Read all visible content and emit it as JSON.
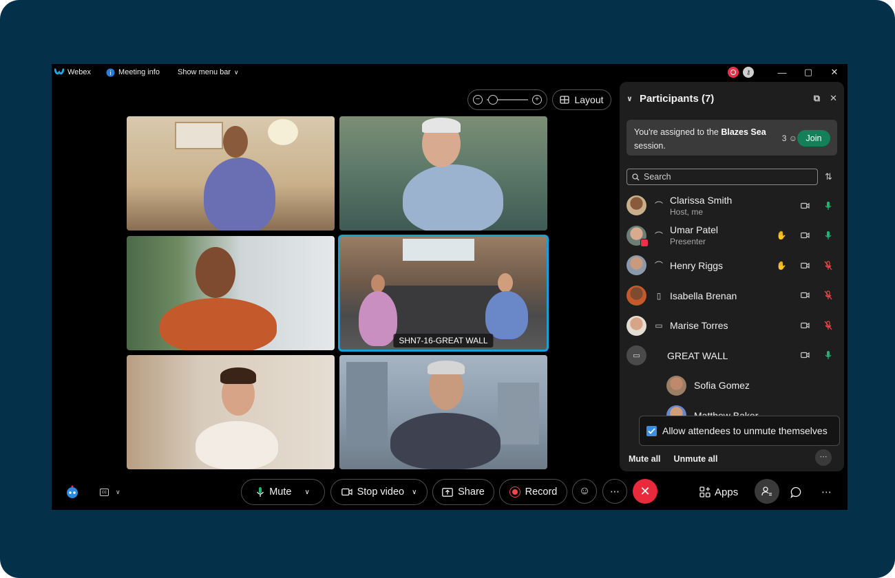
{
  "titlebar": {
    "app_name": "Webex",
    "meeting_info": "Meeting info",
    "show_menu_bar": "Show menu bar"
  },
  "stage": {
    "layout_label": "Layout",
    "zoom_level": 0.05
  },
  "tiles": [
    {
      "name": "Clarissa Smith",
      "label": ""
    },
    {
      "name": "Umar Patel",
      "label": ""
    },
    {
      "name": "Isabella Brenan",
      "label": ""
    },
    {
      "name": "GREAT WALL room",
      "label": "SHN7-16-GREAT WALL"
    },
    {
      "name": "Marise Torres",
      "label": ""
    },
    {
      "name": "Henry Riggs",
      "label": ""
    }
  ],
  "panel": {
    "title": "Participants (7)",
    "assign_prefix": "You're assigned to the ",
    "assign_session": "Blazes Sea",
    "assign_suffix": "session.",
    "assign_count": "3",
    "join_label": "Join",
    "search_placeholder": "Search",
    "participants": [
      {
        "name": "Clarissa Smith",
        "sub": "Host, me",
        "mic": "on"
      },
      {
        "name": "Umar Patel",
        "sub": "Presenter",
        "mic": "on"
      },
      {
        "name": "Henry Riggs",
        "sub": "",
        "mic": "off"
      },
      {
        "name": "Isabella Brenan",
        "sub": "",
        "mic": "off"
      },
      {
        "name": "Marise Torres",
        "sub": "",
        "mic": "off"
      },
      {
        "name": "GREAT WALL",
        "sub": "",
        "mic": "on"
      },
      {
        "name": "Sofia Gomez",
        "sub": "",
        "mic": ""
      },
      {
        "name": "Matthew Baker",
        "sub": "",
        "mic": ""
      }
    ],
    "popup_label": "Allow attendees to unmute themselves",
    "mute_all": "Mute all",
    "unmute_all": "Unmute all"
  },
  "toolbar": {
    "mute": "Mute",
    "stop_video": "Stop video",
    "share": "Share",
    "record": "Record",
    "apps": "Apps"
  },
  "colors": {
    "background": "#05304a",
    "join": "#14805a",
    "end_call": "#e82a3c",
    "mic_on": "#1fb571",
    "mic_off": "#f0474d",
    "active_tile": "#1aa0d8"
  }
}
